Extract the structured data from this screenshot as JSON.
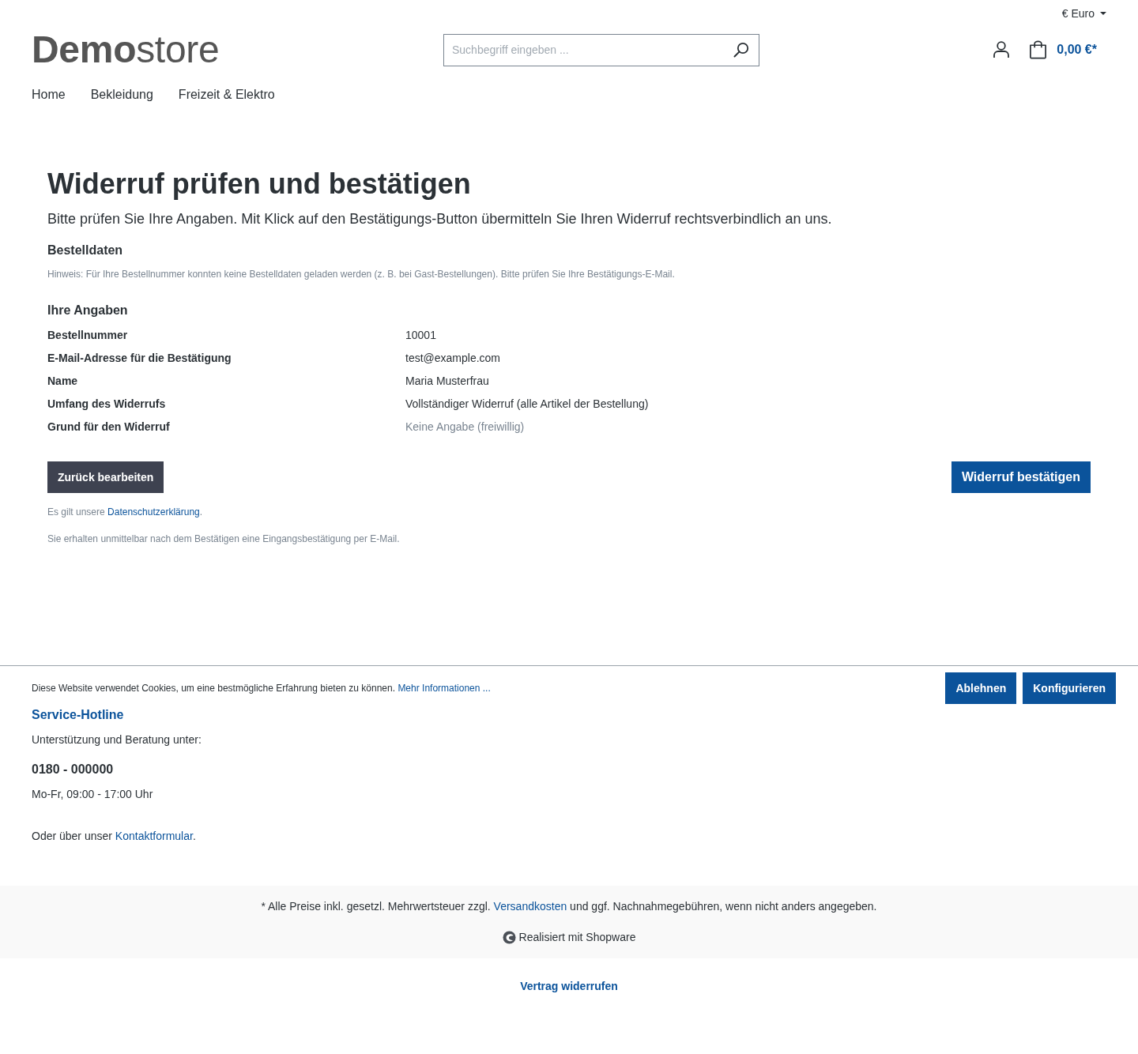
{
  "header": {
    "currency": "€ Euro",
    "logo": {
      "bold": "Demo",
      "light": "store"
    },
    "search": {
      "placeholder": "Suchbegriff eingeben ..."
    },
    "cart_total": "0,00 €*"
  },
  "nav": [
    {
      "label": "Home"
    },
    {
      "label": "Bekleidung"
    },
    {
      "label": "Freizeit & Elektro"
    }
  ],
  "page": {
    "title": "Widerruf prüfen und bestätigen",
    "intro": "Bitte prüfen Sie Ihre Angaben. Mit Klick auf den Bestätigungs-Button übermitteln Sie Ihren Widerruf rechtsverbindlich an uns.",
    "order_data": {
      "heading": "Bestelldaten",
      "hint": "Hinweis: Für Ihre Bestellnummer konnten keine Bestelldaten geladen werden (z. B. bei Gast-Bestellungen). Bitte prüfen Sie Ihre Bestätigungs-E-Mail."
    },
    "details": {
      "heading": "Ihre Angaben",
      "rows": [
        {
          "label": "Bestellnummer",
          "value": "10001",
          "muted": false
        },
        {
          "label": "E-Mail-Adresse für die Bestätigung",
          "value": "test@example.com",
          "muted": false
        },
        {
          "label": "Name",
          "value": "Maria Musterfrau",
          "muted": false
        },
        {
          "label": "Umfang des Widerrufs",
          "value": "Vollständiger Widerruf (alle Artikel der Bestellung)",
          "muted": false
        },
        {
          "label": "Grund für den Widerruf",
          "value": "Keine Angabe (freiwillig)",
          "muted": true
        }
      ]
    },
    "buttons": [
      {
        "label": "Zurück bearbeiten",
        "kind": "secondary"
      },
      {
        "label": "Widerruf bestätigen",
        "kind": "primary"
      }
    ],
    "privacy": {
      "prefix": "Es gilt unsere ",
      "link": "Datenschutzerklärung",
      "suffix": "."
    },
    "notice": "Sie erhalten unmittelbar nach dem Bestätigen eine Eingangsbestätigung per E-Mail."
  },
  "cookie_bar": {
    "text": "Diese Website verwendet Cookies, um eine bestmögliche Erfahrung bieten zu können. ",
    "link": "Mehr Informationen ...",
    "buttons": [
      "Ablehnen",
      "Konfigurieren"
    ]
  },
  "footer": {
    "hotline_title": "Service-Hotline",
    "support_text": "Unterstützung und Beratung unter:",
    "phone": "0180 - 000000",
    "hours": "Mo-Fr, 09:00 - 17:00 Uhr",
    "contact": {
      "prefix": "Oder über unser ",
      "link": "Kontaktformular",
      "suffix": "."
    }
  },
  "bottom": {
    "vat": {
      "prefix": "* Alle Preise inkl. gesetzl. Mehrwertsteuer zzgl. ",
      "link": "Versandkosten",
      "suffix": " und ggf. Nachnahmegebühren, wenn nicht anders angegeben."
    },
    "powered_by": "Realisiert mit Shopware",
    "revoke_link": "Vertrag widerrufen"
  }
}
